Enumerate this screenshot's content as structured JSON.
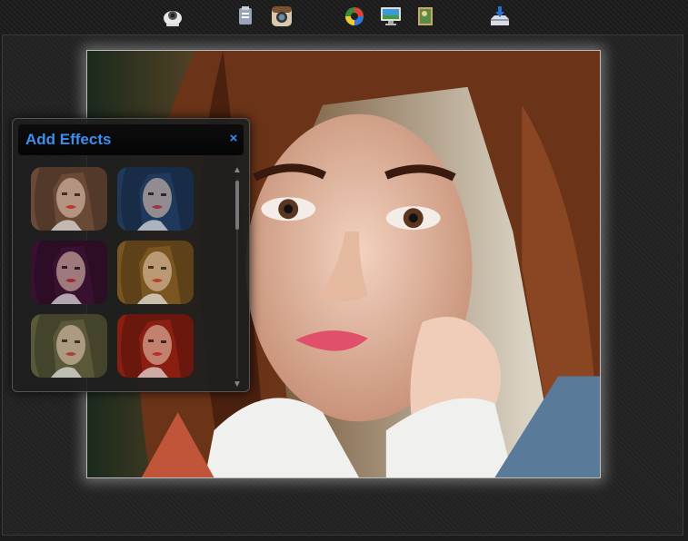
{
  "toolbar": {
    "tools": [
      {
        "name": "webcam",
        "icon": "webcam-icon"
      },
      {
        "name": "paste",
        "icon": "paste-icon"
      },
      {
        "name": "instagram",
        "icon": "instagram-icon"
      },
      {
        "name": "color-picker",
        "icon": "color-wheel-icon"
      },
      {
        "name": "monitor",
        "icon": "monitor-icon"
      },
      {
        "name": "picture",
        "icon": "picture-icon"
      },
      {
        "name": "save",
        "icon": "save-download-icon"
      }
    ]
  },
  "effects_panel": {
    "title": "Add Effects",
    "close_label": "×",
    "scroll_up": "▲",
    "scroll_down": "▼",
    "effects": [
      {
        "id": "effect-1",
        "tint": "#6b4a36"
      },
      {
        "id": "effect-2",
        "tint": "#1f3a5c"
      },
      {
        "id": "effect-3",
        "tint": "#3a1230"
      },
      {
        "id": "effect-4",
        "tint": "#7a5520"
      },
      {
        "id": "effect-5",
        "tint": "#5a5a3a"
      },
      {
        "id": "effect-6",
        "tint": "#8a1f12"
      }
    ]
  },
  "colors": {
    "accent": "#3b8ef0",
    "background": "#1c1c1c"
  }
}
